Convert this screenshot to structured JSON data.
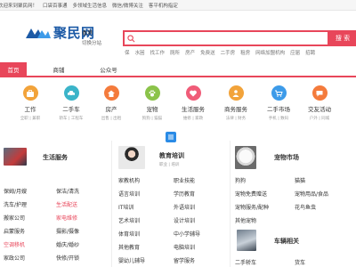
{
  "topbar": {
    "welcome": "欢迎来到聚民网！",
    "items": [
      "口袋百事通",
      "多领域生活信息",
      "微信/微博关注",
      "客平机构指定"
    ]
  },
  "header": {
    "logo_text": "聚民网",
    "city": "香港",
    "city_switch": "切换分站",
    "search_button": "搜 索",
    "hot_words": [
      "保",
      "水困",
      "找工作",
      "厕所",
      "房产",
      "免费送",
      "二手房",
      "租房",
      "网络加盟机构",
      "应届",
      "招聘"
    ]
  },
  "nav": {
    "items": [
      "首页",
      "商铺",
      "公众号"
    ],
    "active_index": 0
  },
  "categories": [
    {
      "label": "工作",
      "subs": "全职  | 兼职",
      "color": "#f2a33a",
      "icon": "briefcase-icon"
    },
    {
      "label": "二手车",
      "subs": "轿车  | 工程车",
      "color": "#3bb4c9",
      "icon": "car-icon"
    },
    {
      "label": "房产",
      "subs": "出售  | 出租",
      "color": "#f47b3c",
      "icon": "house-icon"
    },
    {
      "label": "宠物",
      "subs": "狗狗  | 猫猫",
      "color": "#8bc34a",
      "icon": "paw-icon"
    },
    {
      "label": "生活服务",
      "subs": "维修  | 家政",
      "color": "#f05c78",
      "icon": "heart-icon"
    },
    {
      "label": "商务服务",
      "subs": "法律  | 财务",
      "color": "#f2a33a",
      "icon": "handshake-icon"
    },
    {
      "label": "二手市场",
      "subs": "手机  | 数码",
      "color": "#3d9be9",
      "icon": "cart-icon"
    },
    {
      "label": "交友活动",
      "subs": "户外  | 同城",
      "color": "#f47b3c",
      "icon": "chat-icon"
    }
  ],
  "columns": {
    "life": {
      "title": "生活服务",
      "items": [
        "保姆/月嫂",
        "保洁/清洗",
        "洗车/护理",
        "生活配送",
        "搬家公司",
        "家电维修",
        "启蒙服务",
        "摄影/摄像",
        "空调移机",
        "婚庆/婚纱",
        "家政公司",
        "快修/开锁"
      ],
      "red_indices": [
        3,
        5,
        8
      ]
    },
    "training": {
      "title": "教育培训",
      "sub": "职业  | 培训",
      "items": [
        "家教机构",
        "职业技能",
        "语言培训",
        "学历教育",
        "IT培训",
        "外语培训",
        "艺术培训",
        "设计培训",
        "体育培训",
        "中小学辅导",
        "其他教育",
        "电脑培训",
        "婴幼儿辅导",
        "留学服务"
      ]
    },
    "pets": {
      "title": "宠物市场",
      "items": [
        "狗狗",
        "猫猫",
        "宠物免费赠送",
        "宠物用品/食品",
        "宠物服务/配种",
        "花鸟鱼虫",
        "其他宠物"
      ]
    },
    "vehicles": {
      "title": "车辆相关",
      "items": [
        "二手轿车",
        "货车"
      ]
    }
  },
  "colors": {
    "accent": "#e8465a",
    "brand": "#1c5aa6"
  }
}
